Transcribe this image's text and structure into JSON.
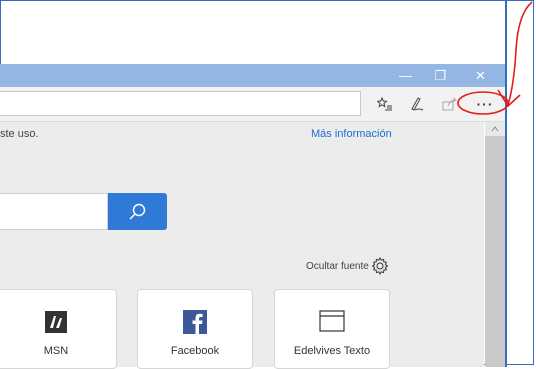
{
  "window": {
    "minimize_glyph": "—",
    "maximize_glyph": "❐",
    "close_glyph": "✕"
  },
  "toolbar": {
    "favorites_icon": "favorites-list-icon",
    "notes_icon": "pen-icon",
    "share_icon": "share-icon",
    "more_label": "···"
  },
  "notice": {
    "text": "ste uso.",
    "link": "Más información"
  },
  "feed": {
    "hide_label": "Ocultar fuente"
  },
  "tiles": [
    {
      "label": "MSN",
      "icon": "msn-icon"
    },
    {
      "label": "Facebook",
      "icon": "facebook-icon"
    },
    {
      "label": "Edelvives Texto",
      "icon": "window-icon"
    }
  ],
  "colors": {
    "accent": "#2f7ad6",
    "titlebar": "#93b6e2",
    "annotation": "#e0201c",
    "facebook": "#3b5998"
  }
}
